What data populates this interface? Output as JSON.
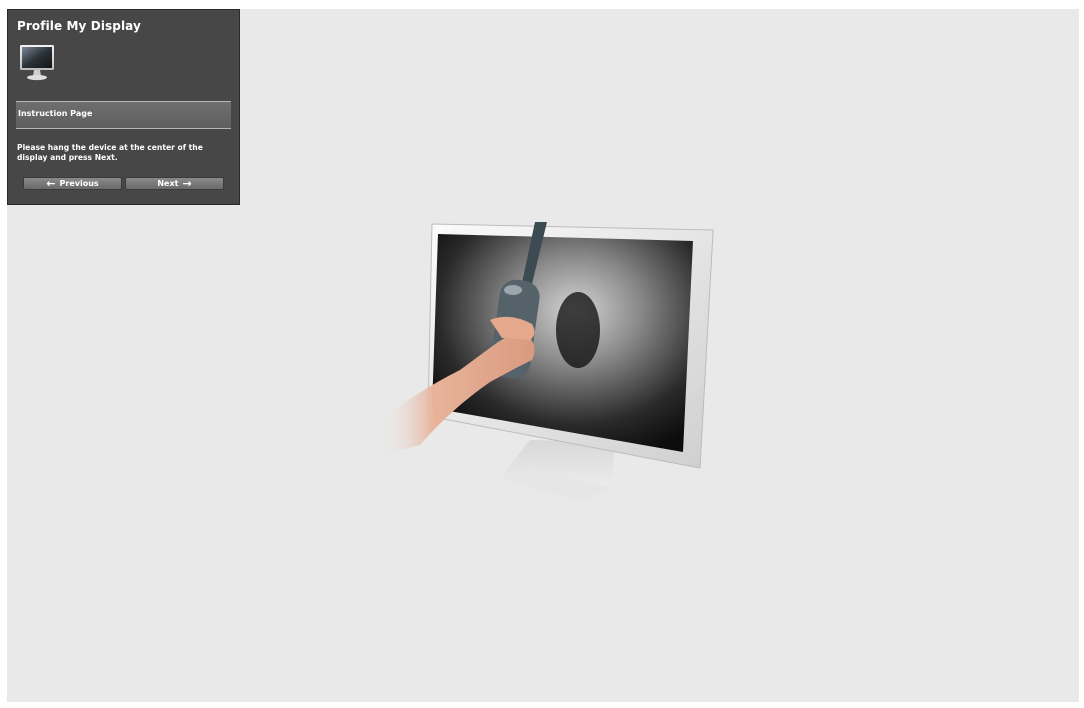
{
  "panel": {
    "title": "Profile My Display",
    "icon": "monitor-icon",
    "section_label": "Instruction Page",
    "instruction": "Please hang the device at the center of the display and press Next.",
    "buttons": {
      "previous_label": "Previous",
      "next_label": "Next"
    }
  },
  "illustration": {
    "subject": "monitor-with-colorimeter-illustration"
  },
  "colors": {
    "panel_background": "#474747",
    "stage_background": "#e9e9e9"
  }
}
